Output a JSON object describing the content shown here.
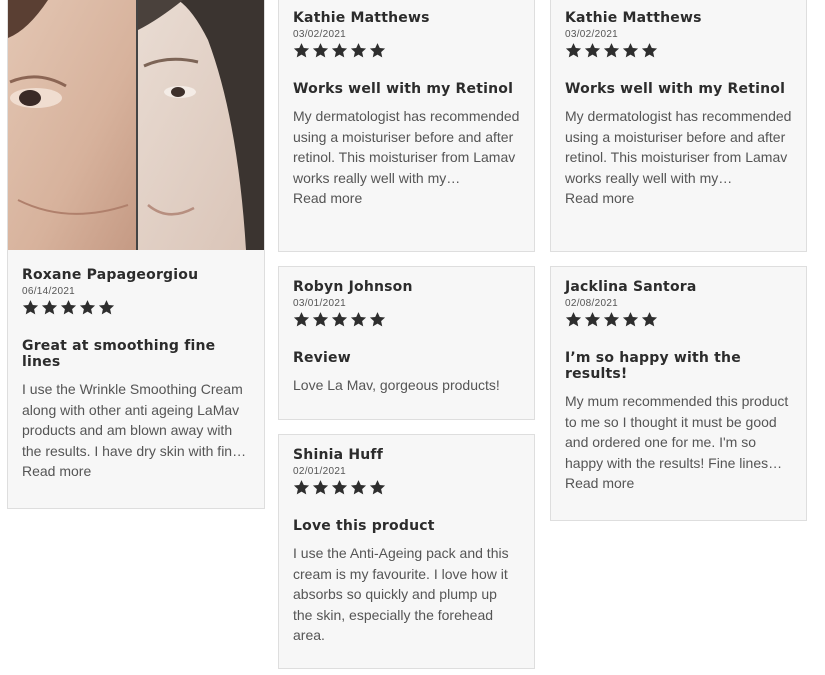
{
  "reviews": [
    {
      "name": "Roxane Papageorgiou",
      "date": "06/14/2021",
      "rating": 5,
      "title": "Great at smoothing fine lines",
      "body": "I use the Wrinkle Smoothing Cream along with other anti ageing LaMav products and am blown away with the results. I have dry skin with fine lines and…",
      "read_more": "Read more",
      "photo": "before-after-face-photo"
    },
    {
      "name": "Kathie Matthews",
      "date": "03/02/2021",
      "rating": 5,
      "title": "Works well with my Retinol",
      "body": "My dermatologist has recommended using a moisturiser before and after retinol. This moisturiser from Lamav works really well with my…",
      "read_more": "Read more"
    },
    {
      "name": "Robyn Johnson",
      "date": "03/01/2021",
      "rating": 5,
      "title": "Review",
      "body": "Love La Mav, gorgeous products!"
    },
    {
      "name": "Shinia Huff",
      "date": "02/01/2021",
      "rating": 5,
      "title": "Love this product",
      "body": "I use the Anti-Ageing pack and this cream is my favourite. I love how it absorbs so quickly and plump up the skin, especially the forehead area."
    },
    {
      "name": "Kathie Matthews",
      "date": "03/02/2021",
      "rating": 5,
      "title": "Works well with my Retinol",
      "body": "My dermatologist has recommended using a moisturiser before and after retinol. This moisturiser from Lamav works really well with my…",
      "read_more": "Read more"
    },
    {
      "name": "Jacklina Santora",
      "date": "02/08/2021",
      "rating": 5,
      "title": "I’m so happy with the results!",
      "body": "My mum recommended this product to me so I thought it must be good and ordered one for me. I'm so happy with the results! Fine lines around my eyes are much…",
      "read_more": "Read more"
    }
  ],
  "colors": {
    "star": "#2e2e2e",
    "card_bg": "#f7f7f7",
    "card_border": "#dedede"
  }
}
